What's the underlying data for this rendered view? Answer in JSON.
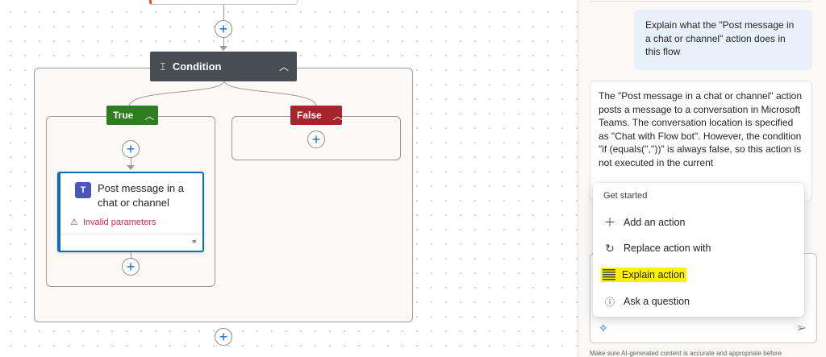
{
  "canvas": {
    "condition": {
      "label": "Condition",
      "icon": "condition-icon"
    },
    "branches": {
      "true": {
        "label": "True",
        "color": "#2e7d1f"
      },
      "false": {
        "label": "False",
        "color": "#a4262c"
      }
    },
    "action_card": {
      "title": "Post message in a chat or channel",
      "error": "Invalid parameters",
      "icon": "teams-icon",
      "accent": "#0f6cbd"
    },
    "add_button_glyph": "+"
  },
  "copilot": {
    "user_message": "Explain what the \"Post message in a chat or channel\" action does in this flow",
    "bot_message": "The \"Post message in a chat or channel\" action posts a message to a conversation in Microsoft Teams. The conversation location is specified as \"Chat with Flow bot\". However, the condition \"if (equals('',''))\" is always false, so this action is not executed in the current",
    "menu": {
      "header": "Get started",
      "items": [
        {
          "label": "Add an action",
          "icon": "plus-icon"
        },
        {
          "label": "Replace action with",
          "icon": "refresh-icon"
        },
        {
          "label": "Explain action",
          "icon": "list-icon",
          "highlighted": true
        },
        {
          "label": "Ask a question",
          "icon": "question-icon"
        }
      ]
    },
    "disclaimer": "Make sure AI-generated content is accurate and appropriate before"
  }
}
